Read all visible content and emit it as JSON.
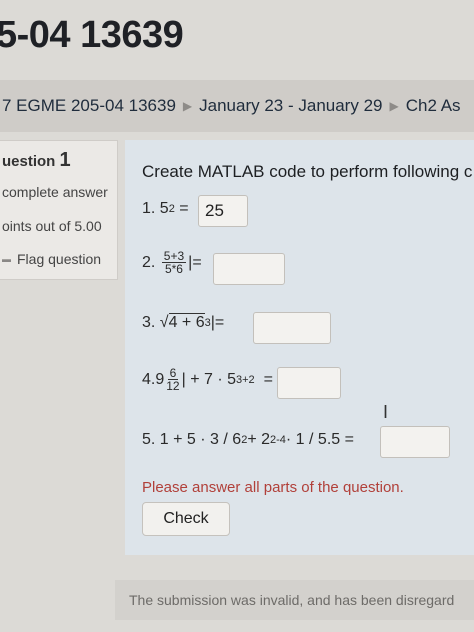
{
  "header": {
    "course_title": "5-04 13639"
  },
  "breadcrumb": {
    "items": [
      "7 EGME 205-04 13639",
      "January 23 - January 29",
      "Ch2 As"
    ]
  },
  "question_info": {
    "label": "uestion",
    "number": "1",
    "state": "complete answer",
    "grade": "oints out of 5.00",
    "flag_label": "Flag question"
  },
  "question": {
    "prompt": "Create MATLAB code to perform following c",
    "parts": {
      "p1": {
        "index": "1.",
        "base": "5",
        "exp": "2",
        "eq": "=",
        "answer": "25"
      },
      "p2": {
        "index": "2.",
        "num": "5+3",
        "den": "5*6",
        "bar": "|",
        "eq": "="
      },
      "p3": {
        "index": "3.",
        "radical": "√",
        "expr": "4 + 6",
        "exp": "3",
        "tail": "|="
      },
      "p4": {
        "index": "4.",
        "lead": "9",
        "num": "6",
        "den": "12",
        "mid": "| + 7 · 5",
        "exp": "3+2",
        "eq": "="
      },
      "p5": {
        "index": "5.",
        "expr": "1 + 5 · 3 / 6",
        "exp1": "2",
        "plus": " + 2",
        "exp2": "2-4",
        "tail": " · 1 / 5.5  ="
      }
    },
    "validation": "Please answer all parts of the question.",
    "check_label": "Check"
  },
  "footer": {
    "message": "The submission was invalid, and has been disregard"
  },
  "colors": {
    "validation_red": "#b1403a",
    "formulation_bg": "#dde4ea"
  }
}
